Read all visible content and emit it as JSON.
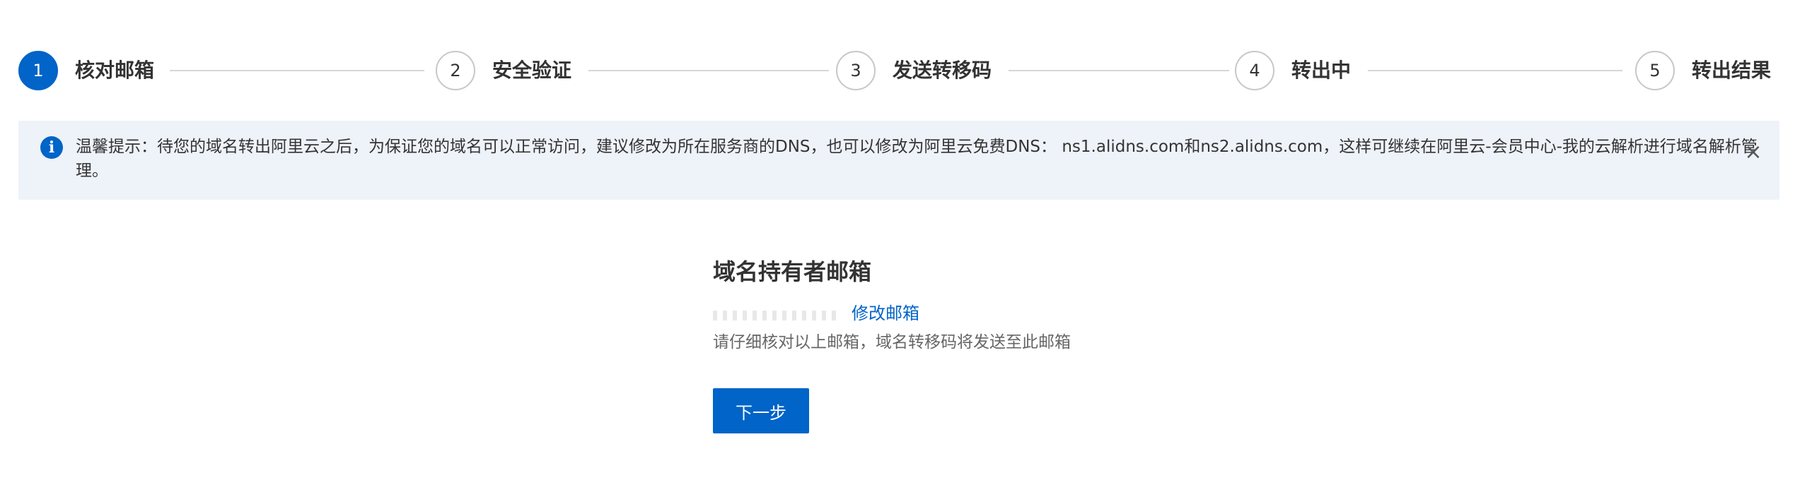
{
  "steps": [
    {
      "number": "1",
      "label": "核对邮箱"
    },
    {
      "number": "2",
      "label": "安全验证"
    },
    {
      "number": "3",
      "label": "发送转移码"
    },
    {
      "number": "4",
      "label": "转出中"
    },
    {
      "number": "5",
      "label": "转出结果"
    }
  ],
  "active_step": 1,
  "notice": {
    "icon": "info-icon",
    "text": "温馨提示：待您的域名转出阿里云之后，为保证您的域名可以正常访问，建议修改为所在服务商的DNS，也可以修改为阿里云免费DNS： ns1.alidns.com和ns2.alidns.com，这样可继续在阿里云-会员中心-我的云解析进行域名解析管理。",
    "close_icon": "close-icon"
  },
  "main": {
    "title": "域名持有者邮箱",
    "edit_label": "修改邮箱",
    "hint": "请仔细核对以上邮箱，域名转移码将发送至此邮箱",
    "next_label": "下一步"
  },
  "colors": {
    "accent": "#0064c8",
    "notice_bg": "#eef2f9",
    "line": "#d6d6d6"
  }
}
